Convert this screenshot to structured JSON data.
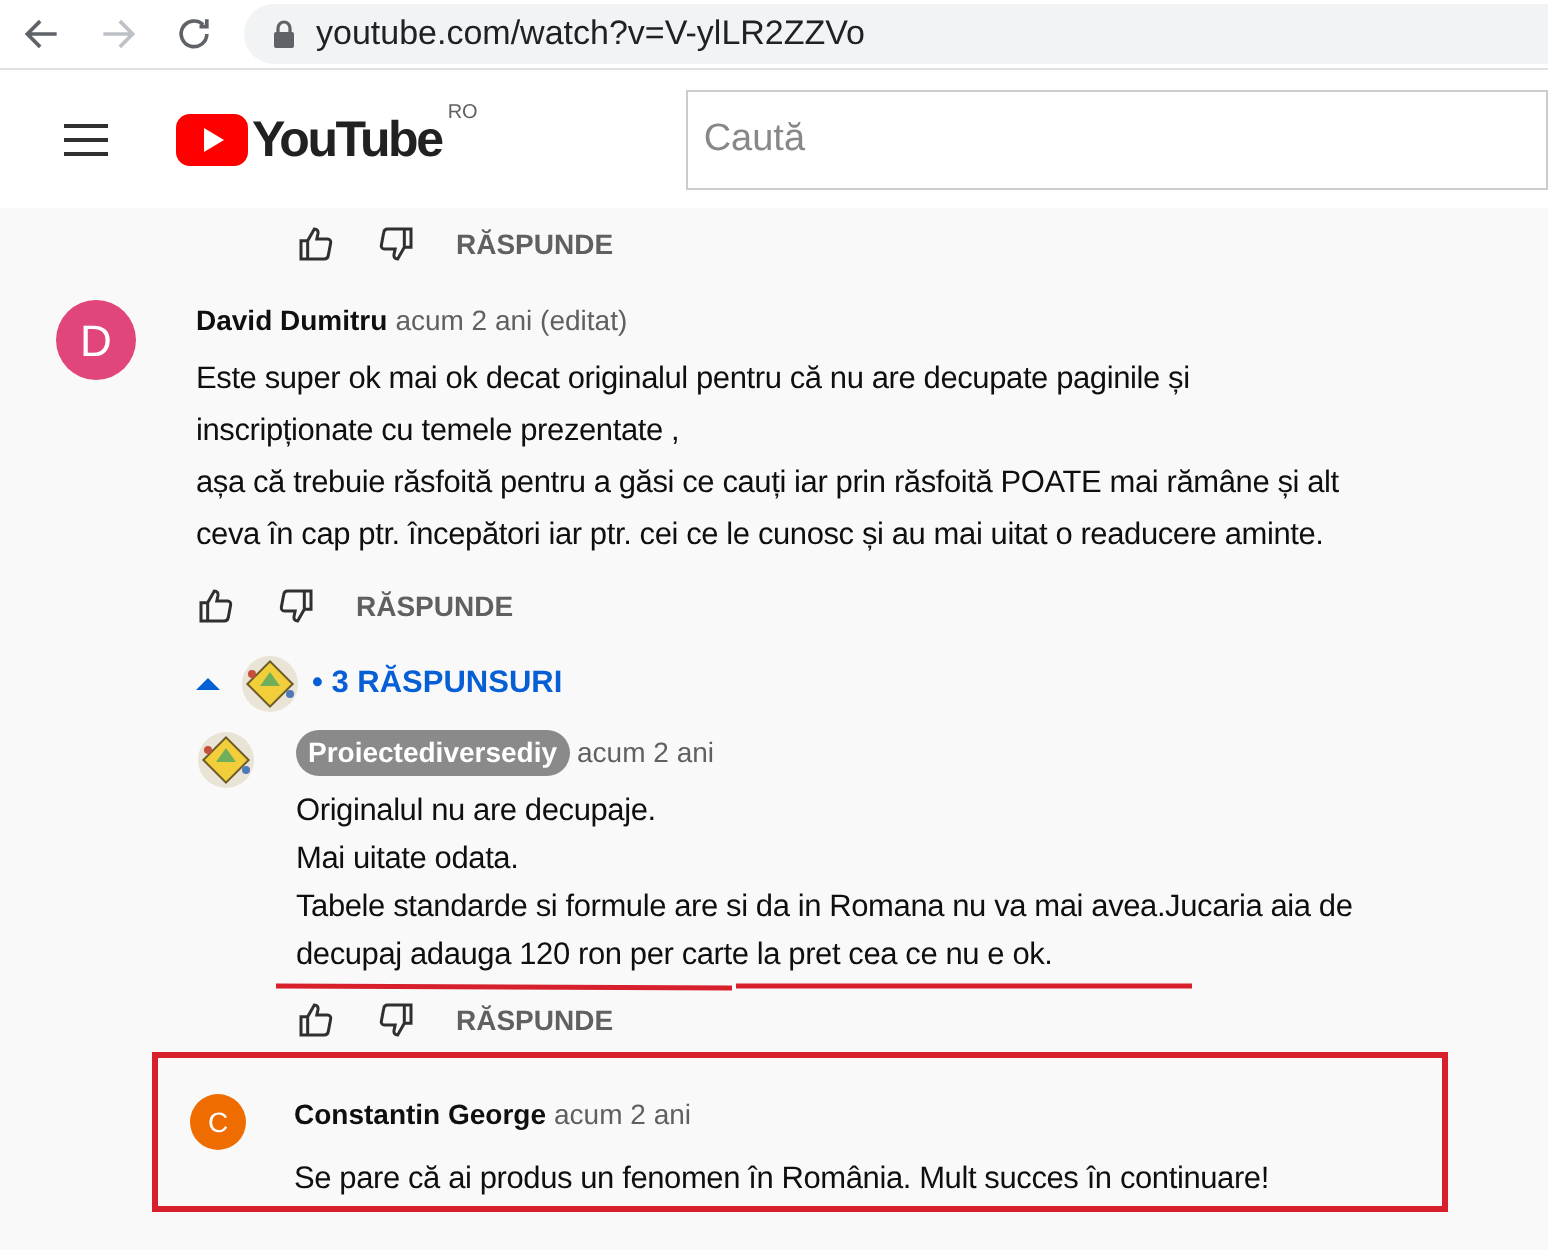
{
  "browser": {
    "url": "youtube.com/watch?v=V-ylLR2ZZVo"
  },
  "header": {
    "logo": "YouTube",
    "country": "RO",
    "search": {
      "placeholder": "Caută"
    }
  },
  "top_actions": {
    "reply": "RĂSPUNDE"
  },
  "comment": {
    "avatar_letter": "D",
    "author": "David Dumitru",
    "time": "acum 2 ani (editat)",
    "lines": [
      "Este super ok mai ok decat originalul pentru că nu are decupate paginile și",
      "inscripționate cu temele prezentate ,",
      "așa că trebuie răsfoită pentru a găsi ce cauți iar prin răsfoită POATE mai rămâne și alt",
      "ceva în cap ptr. începători  iar ptr. cei ce le cunosc și au  mai uitat o readucere aminte."
    ],
    "reply": "RĂSPUNDE",
    "replies_toggle": {
      "expanded": true,
      "label": "• 3 RĂSPUNSURI"
    },
    "replies": [
      {
        "author": "Proiectediversediy",
        "owner": true,
        "time": "acum 2 ani",
        "lines": [
          "Originalul nu are decupaje.",
          "Mai uitate odata.",
          "Tabele standarde si formule are si da in Romana nu  va mai avea.Jucaria aia de",
          "decupaj adauga 120 ron per carte la pret cea ce nu e ok."
        ],
        "underlined": true,
        "reply": "RĂSPUNDE"
      }
    ]
  },
  "highlighted_comment": {
    "avatar_letter": "C",
    "author": "Constantin George",
    "time": "acum 2 ani",
    "text": "Se pare că ai produs un fenomen în România. Mult succes în continuare!"
  }
}
